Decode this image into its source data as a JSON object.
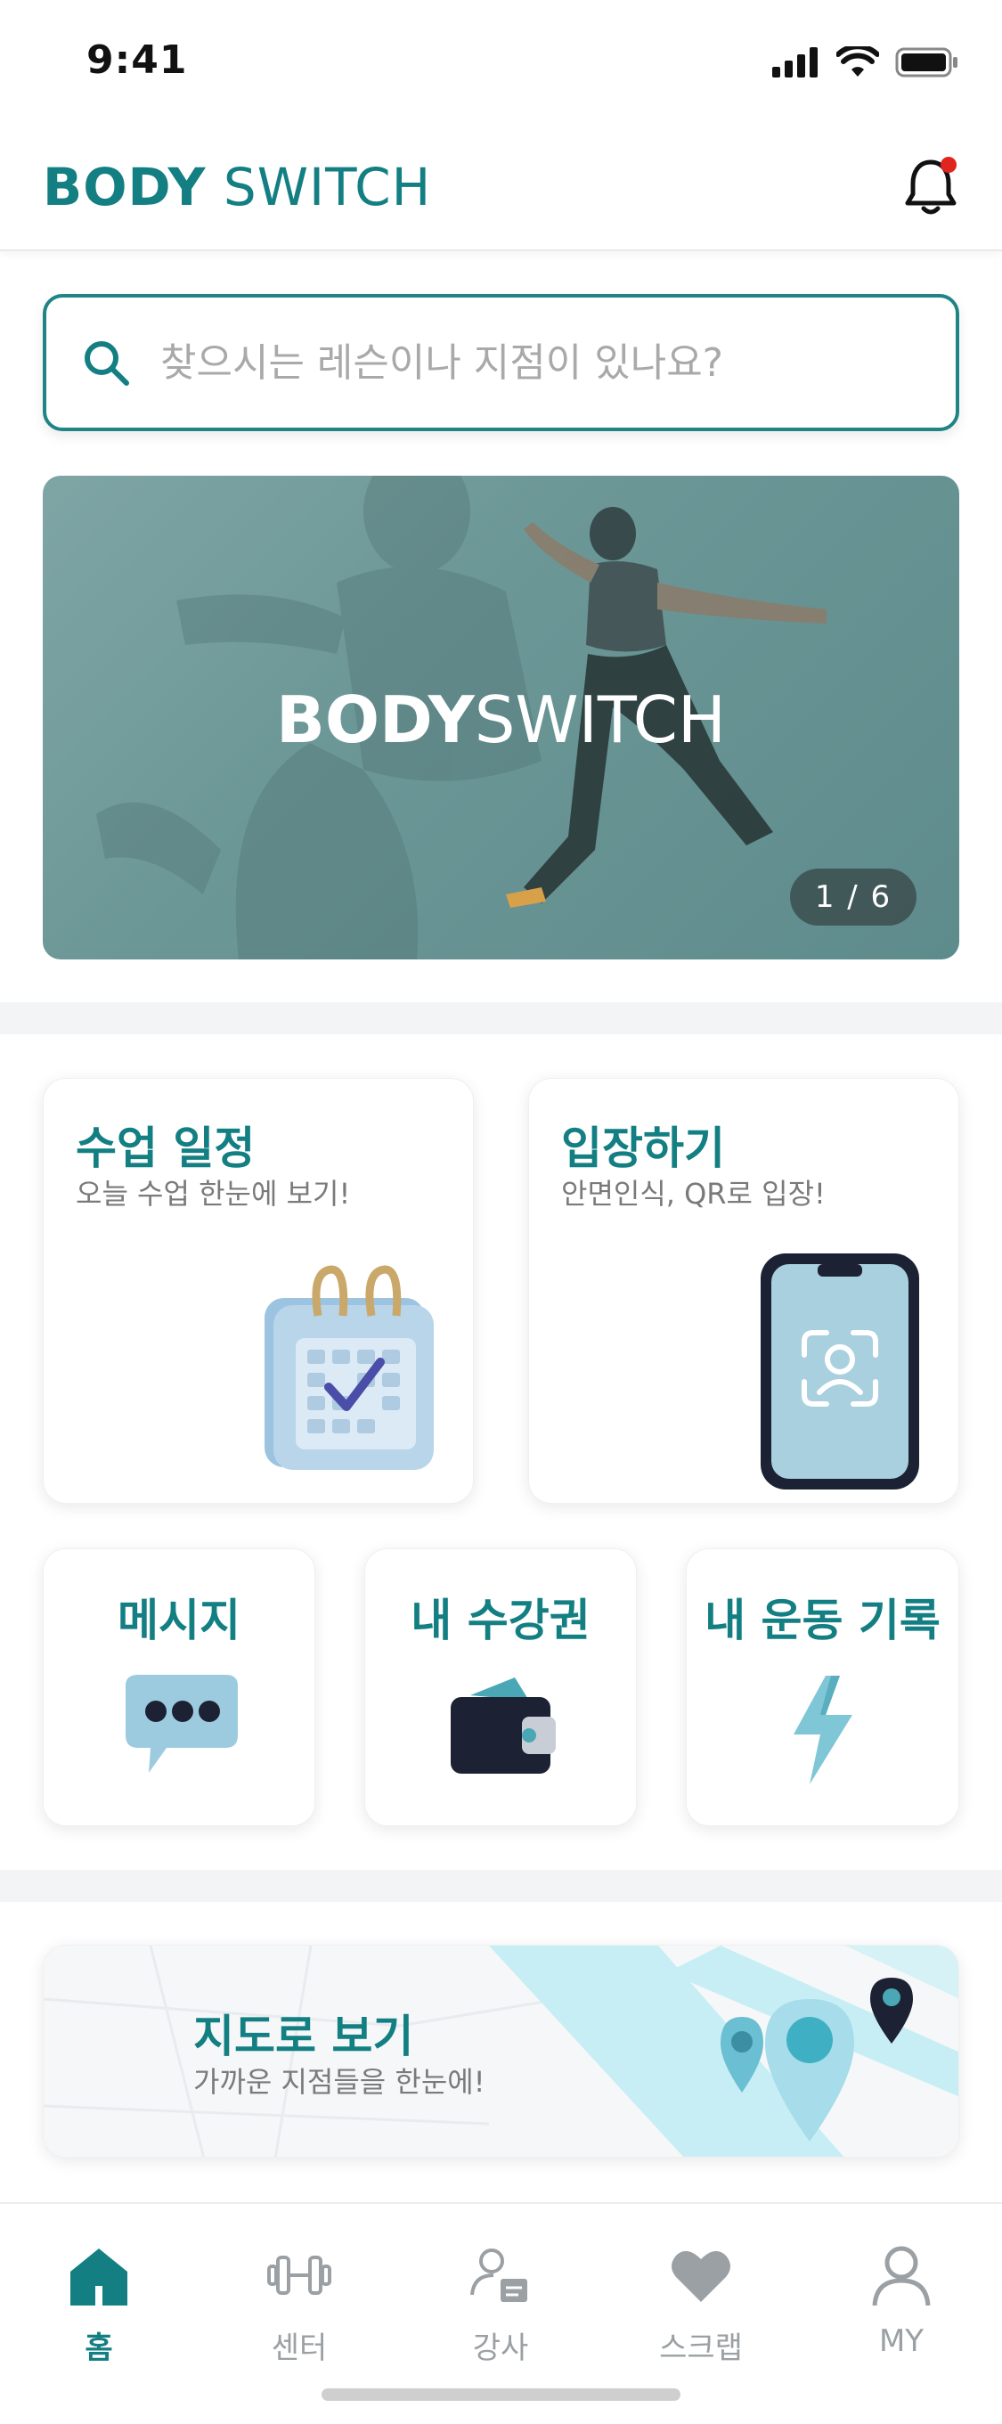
{
  "status_bar": {
    "time": "9:41"
  },
  "header": {
    "logo_bold": "BODY",
    "logo_light": "SWITCH"
  },
  "search": {
    "placeholder": "찾으시는 레슨이나 지점이 있나요?"
  },
  "banner": {
    "title_bold": "BODY",
    "title_light": "SWITCH",
    "pager": "1 / 6"
  },
  "cards": {
    "schedule": {
      "title": "수업 일정",
      "subtitle": "오늘 수업 한눈에 보기!"
    },
    "entry": {
      "title": "입장하기",
      "subtitle": "안면인식, QR로 입장!"
    },
    "message": {
      "title": "메시지"
    },
    "pass": {
      "title": "내 수강권"
    },
    "record": {
      "title": "내 운동 기록"
    }
  },
  "map_card": {
    "title": "지도로 보기",
    "subtitle": "가까운 지점들을 한눈에!"
  },
  "nav": {
    "items": [
      {
        "label": "홈",
        "icon": "home-icon",
        "active": true
      },
      {
        "label": "센터",
        "icon": "dumbbell-icon",
        "active": false
      },
      {
        "label": "강사",
        "icon": "instructor-icon",
        "active": false
      },
      {
        "label": "스크랩",
        "icon": "heart-icon",
        "active": false
      },
      {
        "label": "MY",
        "icon": "user-icon",
        "active": false
      }
    ]
  },
  "colors": {
    "brand": "#137f83",
    "inactive": "#9aa0a3",
    "notification": "#e0241e"
  }
}
